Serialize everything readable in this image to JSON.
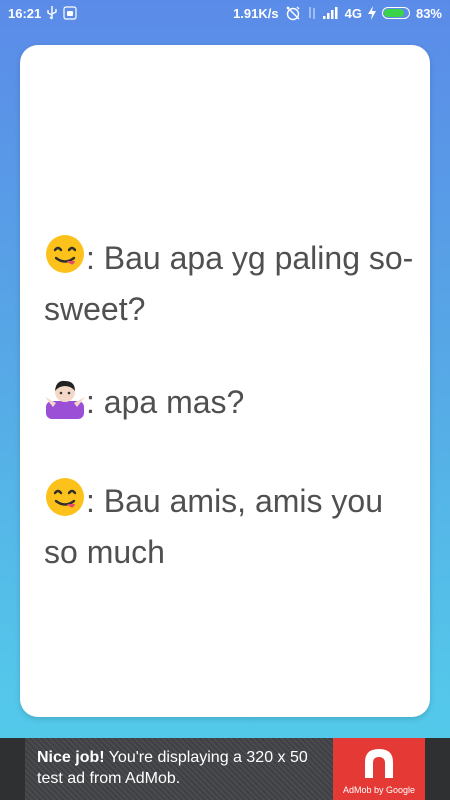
{
  "status_bar": {
    "time": "16:21",
    "network_speed": "1.91K/s",
    "network_type": "4G",
    "battery_percent": "83%",
    "battery_level": 0.83,
    "icons": [
      "usb-icon",
      "android-debug-icon",
      "alarm-off-icon",
      "data-transfer-icon",
      "signal-icon",
      "charging-icon",
      "battery-icon"
    ],
    "battery_color": "#3bd34a"
  },
  "card": {
    "lines": [
      {
        "emoji": "face-savoring-food-emoji",
        "text": ": Bau apa yg paling so-sweet?"
      },
      {
        "emoji": "person-shrugging-emoji",
        "text": ": apa mas?"
      },
      {
        "emoji": "face-savoring-food-emoji",
        "text": ": Bau amis, amis you so much"
      }
    ],
    "text_color": "#505050"
  },
  "ad": {
    "headline": "Nice job!",
    "body": " You're displaying a 320 x 50 test ad from AdMob.",
    "brand_caption": "AdMob by Google",
    "brand_color": "#e53935"
  }
}
